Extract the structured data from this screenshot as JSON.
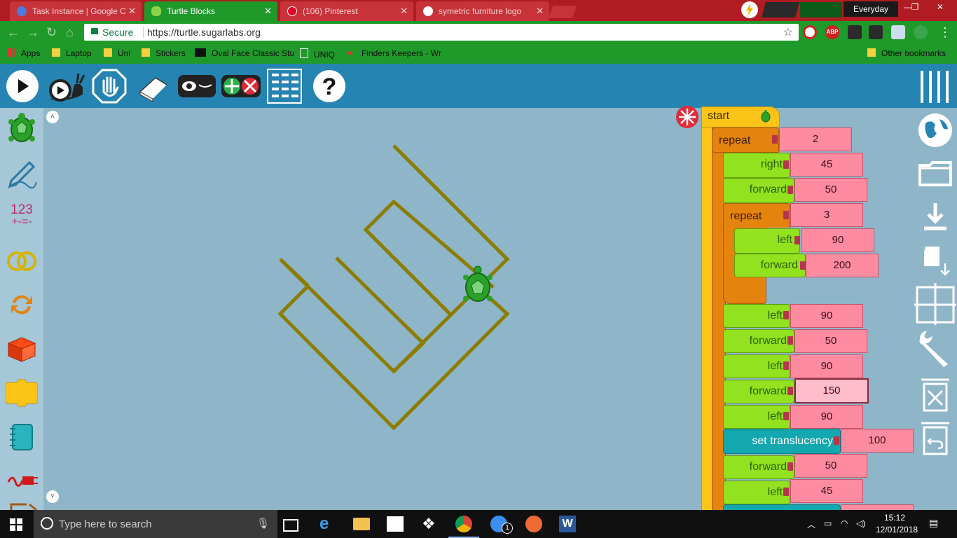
{
  "browser": {
    "tabs": [
      {
        "label": "Task Instance | Google C",
        "active": false
      },
      {
        "label": "Turtle Blocks",
        "active": true
      },
      {
        "label": "(106) Pinterest",
        "active": false
      },
      {
        "label": "symetric furniture logo",
        "active": false
      }
    ],
    "profile_label": "Everyday",
    "secure_label": "Secure",
    "url": "https://turtle.sugarlabs.org",
    "bookmarks": [
      "Apps",
      "Laptop",
      "Uni",
      "Stickers",
      "Oval Face Classic Stu",
      "UNIQ",
      "Finders Keepers - Wr"
    ],
    "other_bookmarks": "Other bookmarks",
    "extensions": [
      "ABP"
    ]
  },
  "toolbar": {
    "buttons": [
      "run-fast",
      "run-slow",
      "stop",
      "clear",
      "hide-blocks",
      "collapse-blocks",
      "grid",
      "help"
    ]
  },
  "palette": {
    "items": [
      "turtle",
      "pen",
      "number",
      "boolean",
      "flow",
      "box",
      "action",
      "extras",
      "media",
      "sensors"
    ],
    "number_label": "123",
    "number_sublabel": "+-=-"
  },
  "blocks": {
    "start_label": "start",
    "repeat1": {
      "label": "repeat",
      "value": "2"
    },
    "right1": {
      "label": "right",
      "value": "45"
    },
    "forward1": {
      "label": "forward",
      "value": "50"
    },
    "repeat2": {
      "label": "repeat",
      "value": "3"
    },
    "left1": {
      "label": "left",
      "value": "90"
    },
    "forward2": {
      "label": "forward",
      "value": "200"
    },
    "left2": {
      "label": "left",
      "value": "90"
    },
    "forward3": {
      "label": "forward",
      "value": "50"
    },
    "left3": {
      "label": "left",
      "value": "90"
    },
    "forward4": {
      "label": "forward",
      "value": "150"
    },
    "left4": {
      "label": "left",
      "value": "90"
    },
    "translucency": {
      "label": "set translucency",
      "value": "100"
    },
    "forward5": {
      "label": "forward",
      "value": "50"
    },
    "left5": {
      "label": "left",
      "value": "45"
    }
  },
  "right_tools": [
    "planet",
    "open",
    "save",
    "new-project",
    "grid-toggle",
    "settings",
    "empty-trash",
    "restore-trash"
  ],
  "colors": {
    "pen": "#8b7d00",
    "canvas": "#8fb5c9",
    "toolbar": "#2584b2"
  },
  "taskbar": {
    "search_placeholder": "Type here to search",
    "time": "15:12",
    "date": "12/01/2018",
    "messenger_badge": "1"
  }
}
